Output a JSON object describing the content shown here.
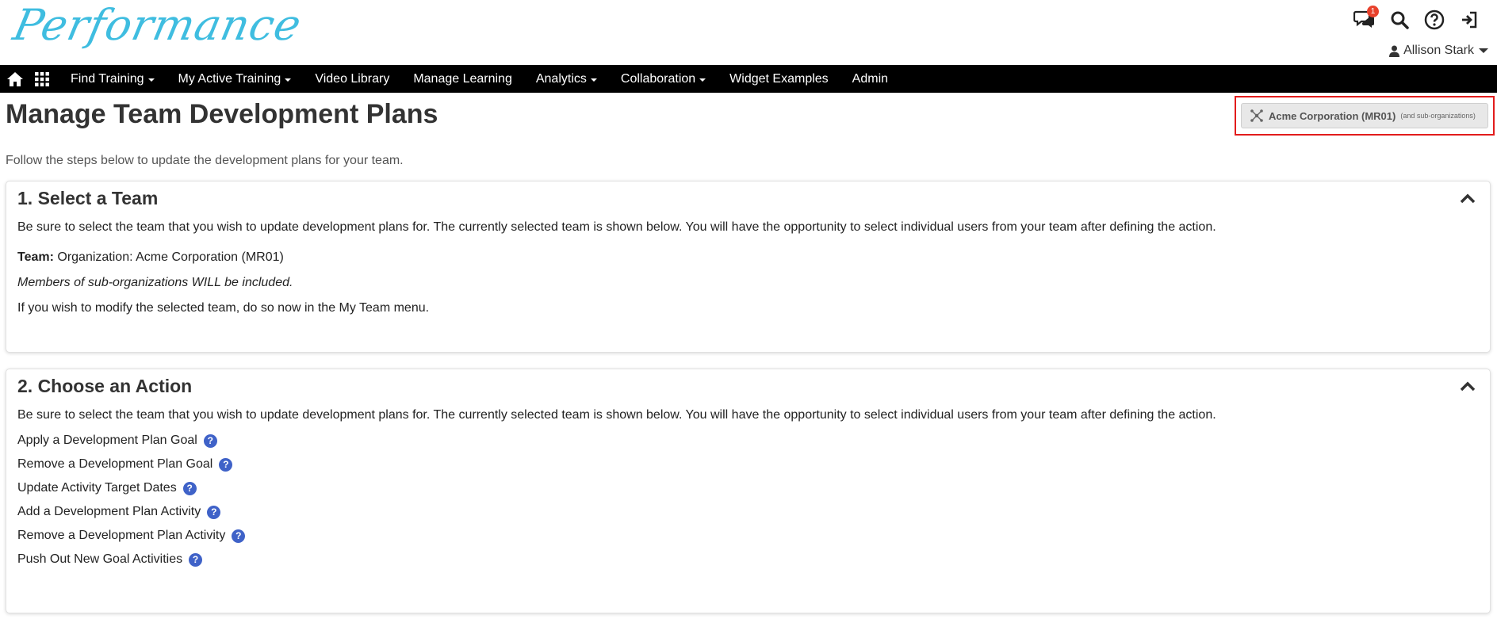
{
  "app": {
    "logo_text": "Performance",
    "notifications_count": "1",
    "user_name": "Allison Stark"
  },
  "icons": {
    "messages": "chat-bubbles-icon",
    "search": "search-icon",
    "help": "help-circle-icon",
    "logout": "sign-out-icon",
    "home": "home-icon",
    "apps": "grid-apps-icon"
  },
  "nav": {
    "items": [
      {
        "label": "Find Training",
        "dropdown": true
      },
      {
        "label": "My Active Training",
        "dropdown": true
      },
      {
        "label": "Video Library",
        "dropdown": false
      },
      {
        "label": "Manage Learning",
        "dropdown": false
      },
      {
        "label": "Analytics",
        "dropdown": true
      },
      {
        "label": "Collaboration",
        "dropdown": true
      },
      {
        "label": "Widget Examples",
        "dropdown": false
      },
      {
        "label": "Admin",
        "dropdown": false
      }
    ]
  },
  "page": {
    "title": "Manage Team Development Plans",
    "intro": "Follow the steps below to update the development plans for your team.",
    "org_button": {
      "name": "Acme Corporation (MR01)",
      "sub": "(and sub-organizations)"
    }
  },
  "step1": {
    "title": "1. Select a Team",
    "desc": "Be sure to select the team that you wish to update development plans for. The currently selected team is shown below. You will have the opportunity to select individual users from your team after defining the action.",
    "team_label": "Team:",
    "team_value": " Organization: Acme Corporation (MR01)",
    "members_note": "Members of sub-organizations WILL be included.",
    "modify_note": "If you wish to modify the selected team, do so now in the My Team menu."
  },
  "step2": {
    "title": "2. Choose an Action",
    "desc": "Be sure to select the team that you wish to update development plans for. The currently selected team is shown below. You will have the opportunity to select individual users from your team after defining the action.",
    "actions": [
      "Apply a Development Plan Goal",
      "Remove a Development Plan Goal",
      "Update Activity Target Dates",
      "Add a Development Plan Activity",
      "Remove a Development Plan Activity",
      "Push Out New Goal Activities"
    ],
    "help_glyph": "?"
  },
  "colors": {
    "logo": "#3fbde0",
    "nav_bg": "#000000",
    "badge": "#e8412c",
    "help_icon": "#3f62c8",
    "highlight_border": "#e21c1c"
  }
}
